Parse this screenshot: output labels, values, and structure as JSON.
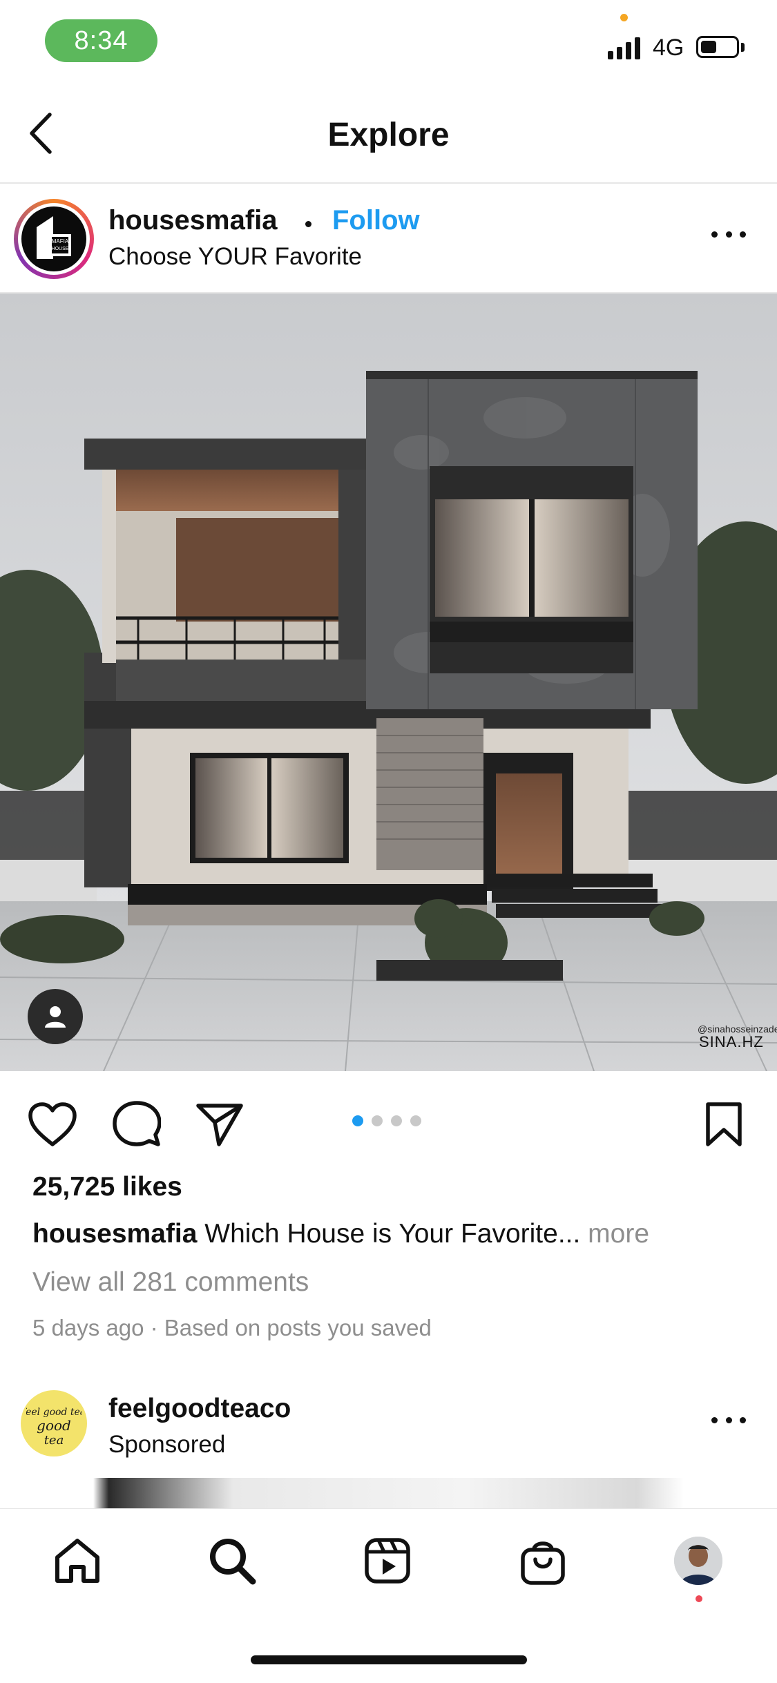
{
  "status_bar": {
    "time": "8:34",
    "network": "4G"
  },
  "header": {
    "title": "Explore"
  },
  "post": {
    "username": "housesmafia",
    "follow_label": "Follow",
    "subtitle": "Choose YOUR Favorite",
    "avatar_text": [
      "MAFIA",
      "HOUSE"
    ],
    "watermark_handle": "@sinahosseinzade",
    "watermark_signature": "SINA.HZ",
    "likes": "25,725 likes",
    "caption_user": "housesmafia",
    "caption_text": " Which House is Your Favorite...",
    "caption_more": " more",
    "view_comments": "View all 281 comments",
    "meta": "5 days ago · Based on posts you saved",
    "carousel": {
      "count": 4,
      "active": 1
    }
  },
  "next_post": {
    "username": "feelgoodteaco",
    "label": "Sponsored",
    "avatar_text": "feel good tea"
  },
  "tabs": [
    "home-icon",
    "search-icon",
    "reels-icon",
    "shop-icon",
    "profile-avatar"
  ],
  "colors": {
    "accent": "#1d9bf0",
    "status_pill": "#5cb85c",
    "muted": "#8e8e8e",
    "notification": "#ed4956"
  }
}
